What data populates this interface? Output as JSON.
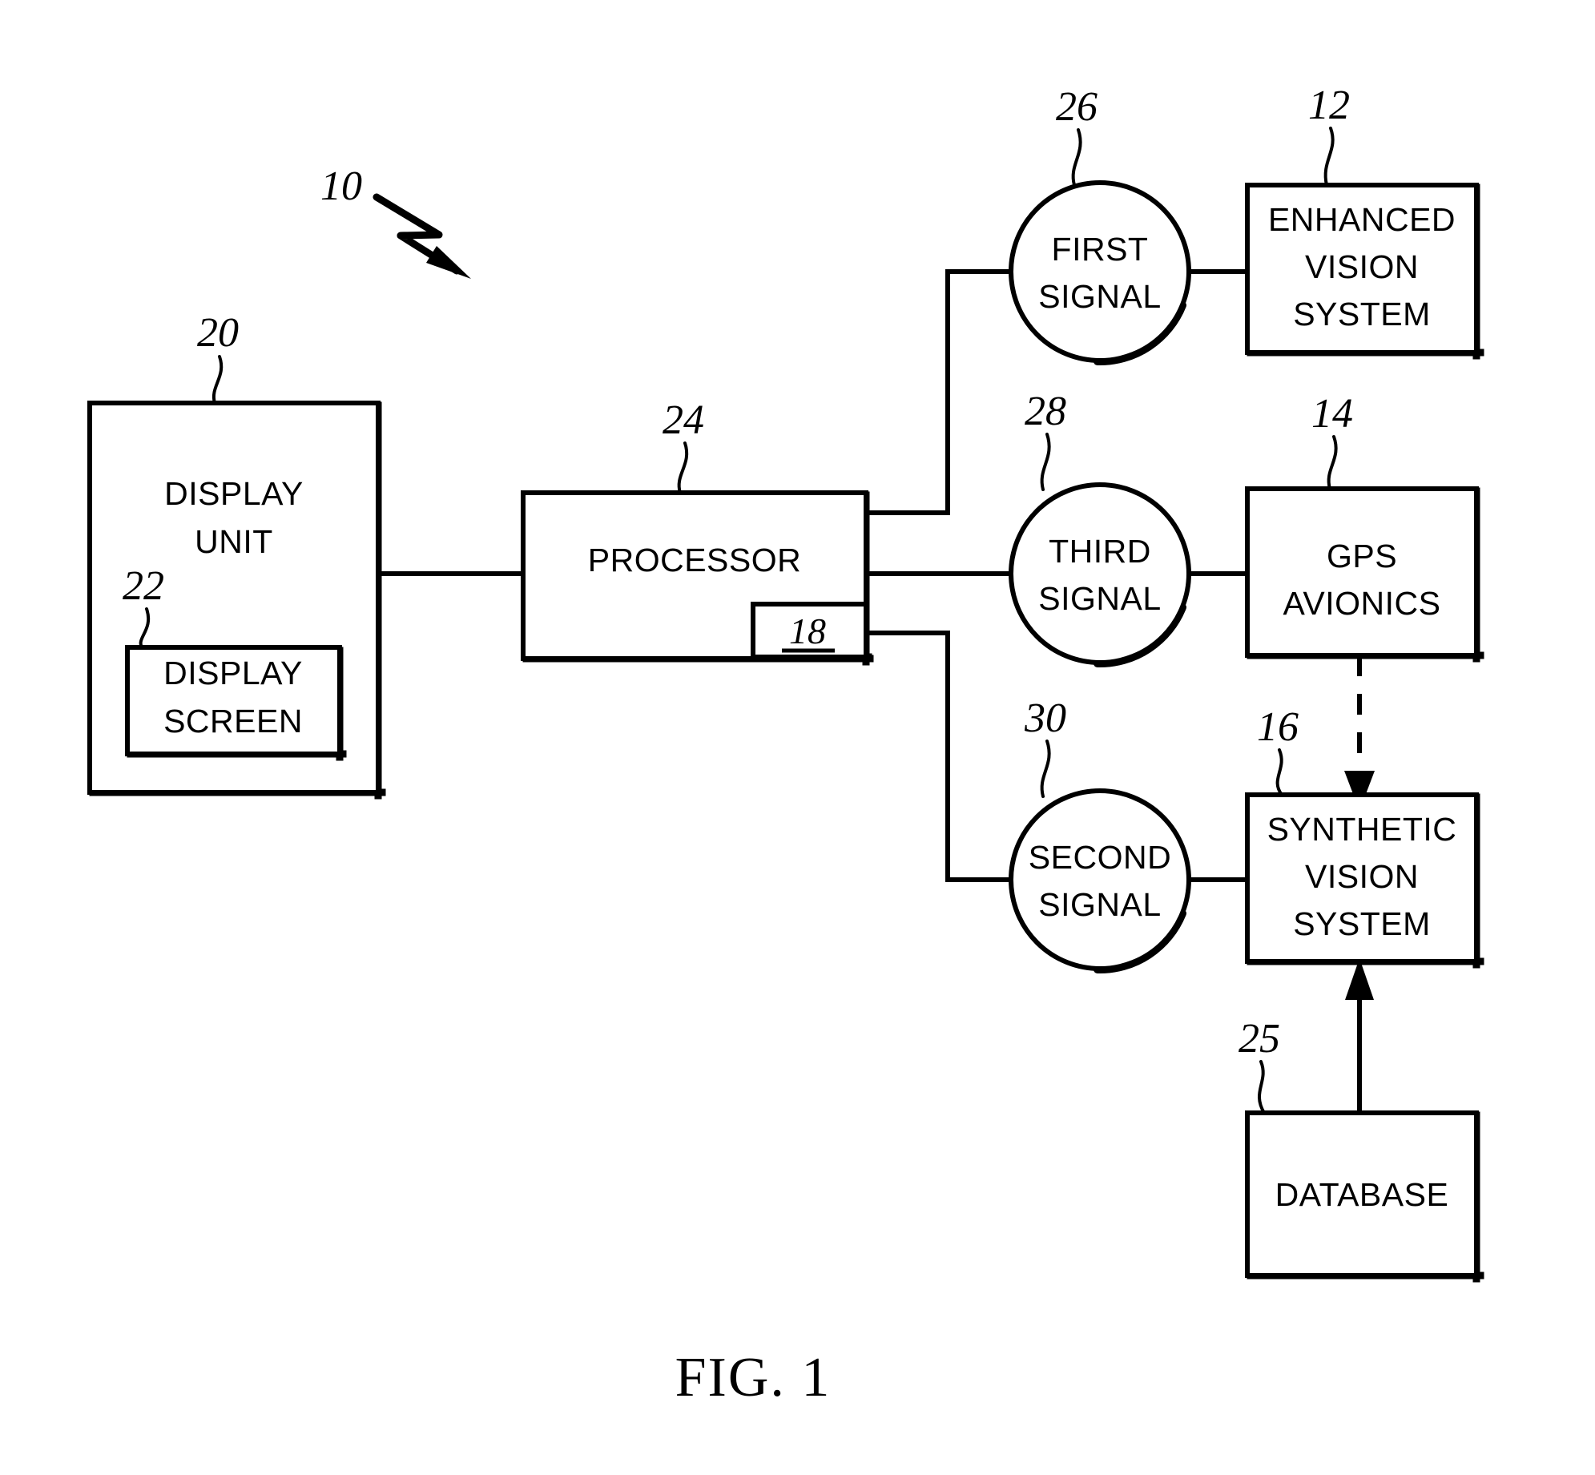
{
  "figure": {
    "caption": "FIG. 1",
    "system_ref": "10"
  },
  "blocks": [
    {
      "id": "display-unit",
      "ref": "20",
      "lines": [
        "DISPLAY",
        "UNIT"
      ]
    },
    {
      "id": "display-screen",
      "ref": "22",
      "lines": [
        "DISPLAY",
        "SCREEN"
      ]
    },
    {
      "id": "processor",
      "ref": "24",
      "lines": [
        "PROCESSOR"
      ],
      "sub_ref": "18"
    },
    {
      "id": "enhanced-vision-system",
      "ref": "12",
      "lines": [
        "ENHANCED",
        "VISION",
        "SYSTEM"
      ]
    },
    {
      "id": "gps-avionics",
      "ref": "14",
      "lines": [
        "GPS",
        "AVIONICS"
      ]
    },
    {
      "id": "synthetic-vision-system",
      "ref": "16",
      "lines": [
        "SYNTHETIC",
        "VISION",
        "SYSTEM"
      ]
    },
    {
      "id": "database",
      "ref": "25",
      "lines": [
        "DATABASE"
      ]
    }
  ],
  "signals": [
    {
      "id": "first-signal",
      "ref": "26",
      "lines": [
        "FIRST",
        "SIGNAL"
      ]
    },
    {
      "id": "third-signal",
      "ref": "28",
      "lines": [
        "THIRD",
        "SIGNAL"
      ]
    },
    {
      "id": "second-signal",
      "ref": "30",
      "lines": [
        "SECOND",
        "SIGNAL"
      ]
    }
  ],
  "colors": {
    "ink": "#000000",
    "paper": "#ffffff"
  }
}
